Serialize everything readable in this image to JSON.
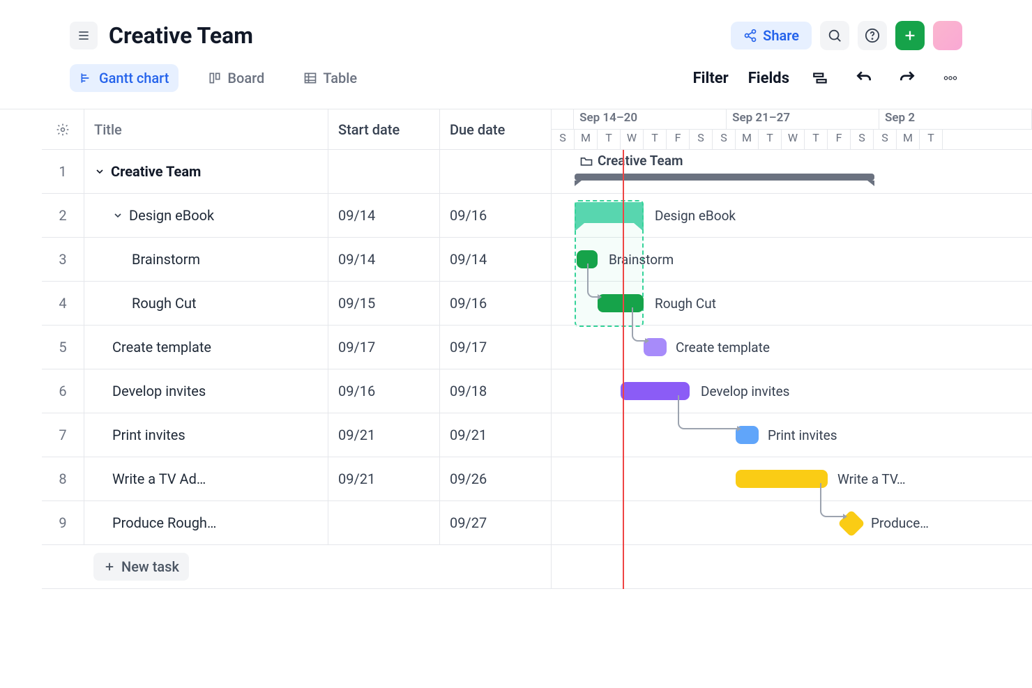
{
  "page_title": "Creative Team",
  "top_actions": {
    "share": "Share"
  },
  "view_tabs": {
    "gantt": "Gantt chart",
    "board": "Board",
    "table": "Table"
  },
  "view_actions": {
    "filter": "Filter",
    "fields": "Fields"
  },
  "sheet_headers": {
    "title": "Title",
    "start": "Start date",
    "due": "Due date"
  },
  "week_headers": [
    "Sep 14–20",
    "Sep 21–27",
    "Sep 2"
  ],
  "day_initials": [
    "S",
    "M",
    "T",
    "W",
    "T",
    "F",
    "S",
    "S",
    "M",
    "T",
    "W",
    "T",
    "F",
    "S",
    "S",
    "M",
    "T"
  ],
  "rows": [
    {
      "n": 1,
      "title": "Creative Team",
      "start": "",
      "due": "",
      "bold": true,
      "indent": 0,
      "chev": true
    },
    {
      "n": 2,
      "title": "Design eBook",
      "start": "09/14",
      "due": "09/16",
      "indent": 1,
      "chev": true
    },
    {
      "n": 3,
      "title": "Brainstorm",
      "start": "09/14",
      "due": "09/14",
      "indent": 2
    },
    {
      "n": 4,
      "title": "Rough Cut",
      "start": "09/15",
      "due": "09/16",
      "indent": 2
    },
    {
      "n": 5,
      "title": "Create template",
      "start": "09/17",
      "due": "09/17",
      "indent": 1
    },
    {
      "n": 6,
      "title": "Develop invites",
      "start": "09/16",
      "due": "09/18",
      "indent": 1
    },
    {
      "n": 7,
      "title": "Print invites",
      "start": "09/21",
      "due": "09/21",
      "indent": 1
    },
    {
      "n": 8,
      "title": "Write a TV Ad…",
      "start": "09/21",
      "due": "09/26",
      "indent": 1
    },
    {
      "n": 9,
      "title": "Produce Rough…",
      "start": "",
      "due": "09/27",
      "indent": 1
    }
  ],
  "gantt_labels": {
    "creative_team": "Creative Team",
    "design_ebook": "Design eBook",
    "brainstorm": "Brainstorm",
    "rough_cut": "Rough Cut",
    "create_template": "Create template",
    "develop_invites": "Develop invites",
    "print_invites": "Print invites",
    "write_tv": "Write a TV…",
    "produce": "Produce…"
  },
  "new_task": "New task",
  "colors": {
    "green": "#16a34a",
    "mint": "#5ad6b0",
    "purple": "#a78bfa",
    "purple_dark": "#8b5cf6",
    "blue": "#60a5fa",
    "yellow": "#facc15"
  }
}
